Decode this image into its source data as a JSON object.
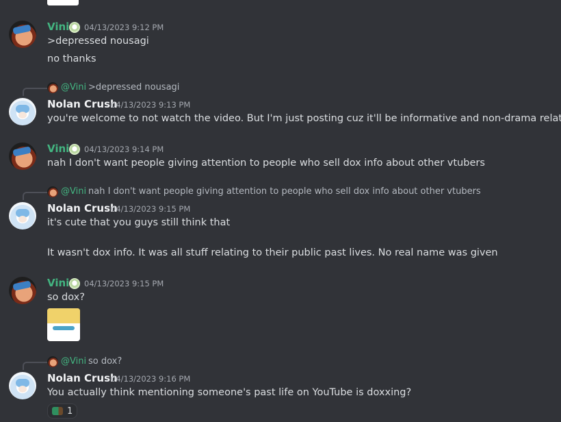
{
  "messages": {
    "m1": {
      "author": "Vini",
      "timestamp": "04/13/2023 9:12 PM",
      "lines": [
        ">depressed nousagi",
        "no thanks"
      ]
    },
    "m2": {
      "reply": {
        "mention": "@Vini",
        "text": ">depressed nousagi"
      },
      "author": "Nolan Crush",
      "timestamp": "04/13/2023 9:13 PM",
      "lines": [
        "you're welcome to not watch the video. But I'm just posting cuz it'll be informative and non-drama related"
      ]
    },
    "m3": {
      "author": "Vini",
      "timestamp": "04/13/2023 9:14 PM",
      "lines": [
        "nah I don't want people giving attention to people who sell dox info about other vtubers"
      ]
    },
    "m4": {
      "reply": {
        "mention": "@Vini",
        "text": "nah I don't want people giving attention to people who sell dox info about other vtubers"
      },
      "author": "Nolan Crush",
      "timestamp": "04/13/2023 9:15 PM",
      "lines": [
        "it's cute that you guys still think that",
        "It wasn't dox info. It was all stuff relating to their public past lives. No real name was given"
      ]
    },
    "m5": {
      "author": "Vini",
      "timestamp": "04/13/2023 9:15 PM",
      "lines": [
        "so dox?"
      ]
    },
    "m6": {
      "reply": {
        "mention": "@Vini",
        "text": "so dox?"
      },
      "author": "Nolan Crush",
      "timestamp": "04/13/2023 9:16 PM",
      "lines": [
        "You actually think mentioning someone's past life on YouTube is doxxing?"
      ],
      "reaction": {
        "emoji": "turtle-emoji",
        "count": "1"
      }
    }
  },
  "colors": {
    "background": "#313338",
    "vini_name": "#43b581",
    "text": "#dbdee1",
    "timestamp": "#a5a9b0"
  }
}
